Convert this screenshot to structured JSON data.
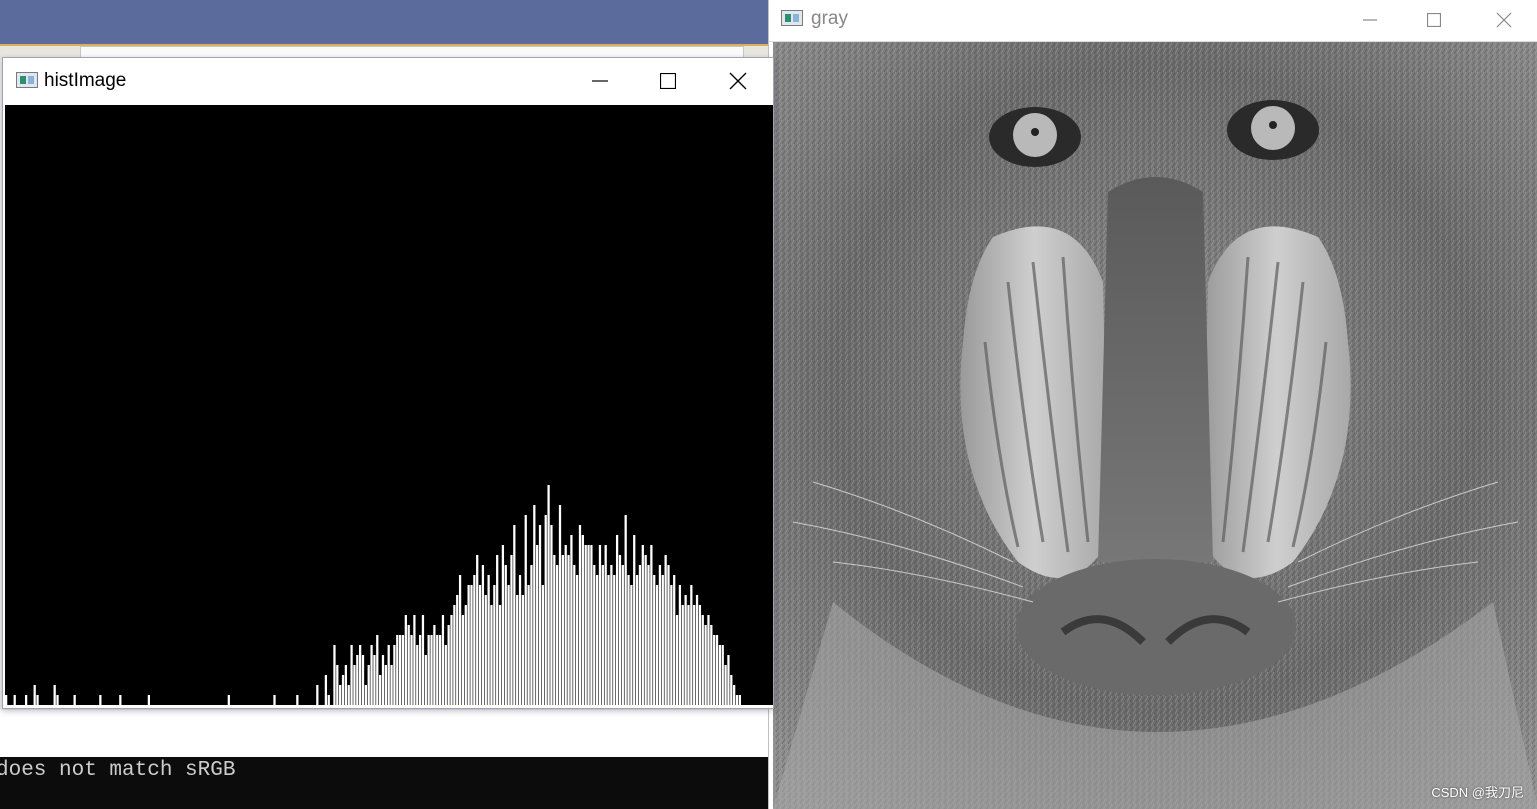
{
  "background": {
    "console_text": "does not match sRGB"
  },
  "hist_window": {
    "title": "histImage",
    "icon": "app-window-icon",
    "controls": [
      "minimize-icon",
      "maximize-icon",
      "close-icon"
    ],
    "colors": {
      "background": "#000000",
      "bars": "#ffffff"
    },
    "chart_data": {
      "type": "bar",
      "title": "",
      "xlabel": "",
      "ylabel": "",
      "x": [
        0,
        255
      ],
      "values": [
        1,
        0,
        0,
        1,
        0,
        0,
        0,
        1,
        0,
        0,
        2,
        1,
        0,
        0,
        0,
        0,
        0,
        2,
        1,
        0,
        0,
        0,
        0,
        0,
        1,
        0,
        0,
        0,
        0,
        0,
        0,
        0,
        0,
        1,
        0,
        0,
        0,
        0,
        0,
        0,
        1,
        0,
        0,
        0,
        0,
        0,
        0,
        0,
        0,
        0,
        1,
        0,
        0,
        0,
        0,
        0,
        0,
        0,
        0,
        0,
        0,
        0,
        0,
        0,
        0,
        0,
        0,
        0,
        0,
        0,
        0,
        0,
        0,
        0,
        0,
        0,
        0,
        0,
        1,
        0,
        0,
        0,
        0,
        0,
        0,
        0,
        0,
        0,
        0,
        0,
        0,
        0,
        0,
        0,
        1,
        0,
        0,
        0,
        0,
        0,
        0,
        0,
        1,
        0,
        0,
        0,
        0,
        0,
        0,
        2,
        0,
        0,
        3,
        1,
        0,
        6,
        4,
        2,
        3,
        4,
        2,
        6,
        4,
        5,
        6,
        5,
        2,
        4,
        6,
        5,
        7,
        3,
        5,
        4,
        6,
        4,
        6,
        7,
        7,
        7,
        9,
        8,
        7,
        9,
        6,
        7,
        9,
        5,
        7,
        7,
        8,
        7,
        7,
        9,
        6,
        8,
        9,
        10,
        11,
        13,
        9,
        10,
        12,
        12,
        13,
        15,
        12,
        14,
        11,
        13,
        10,
        12,
        15,
        10,
        16,
        14,
        12,
        15,
        18,
        11,
        13,
        11,
        19,
        12,
        14,
        20,
        16,
        18,
        12,
        19,
        22,
        18,
        15,
        14,
        20,
        15,
        16,
        15,
        17,
        14,
        13,
        18,
        17,
        16,
        16,
        16,
        14,
        13,
        16,
        14,
        16,
        13,
        14,
        13,
        17,
        15,
        14,
        19,
        13,
        12,
        17,
        13,
        14,
        16,
        15,
        14,
        16,
        13,
        12,
        14,
        13,
        15,
        14,
        12,
        13,
        9,
        12,
        10,
        11,
        10,
        12,
        10,
        11,
        10,
        9,
        8,
        9,
        8,
        7,
        7,
        6,
        6,
        4,
        5,
        3,
        2,
        1,
        1,
        0,
        0,
        0,
        0,
        0,
        0,
        0,
        0,
        0,
        0,
        0
      ],
      "ylim": [
        0,
        60
      ]
    }
  },
  "gray_window": {
    "title": "gray",
    "icon": "app-window-icon",
    "controls": [
      "minimize-icon",
      "maximize-icon",
      "close-icon"
    ],
    "image_description": "grayscale mandrill face photo",
    "watermark": "CSDN @我刀尼"
  }
}
